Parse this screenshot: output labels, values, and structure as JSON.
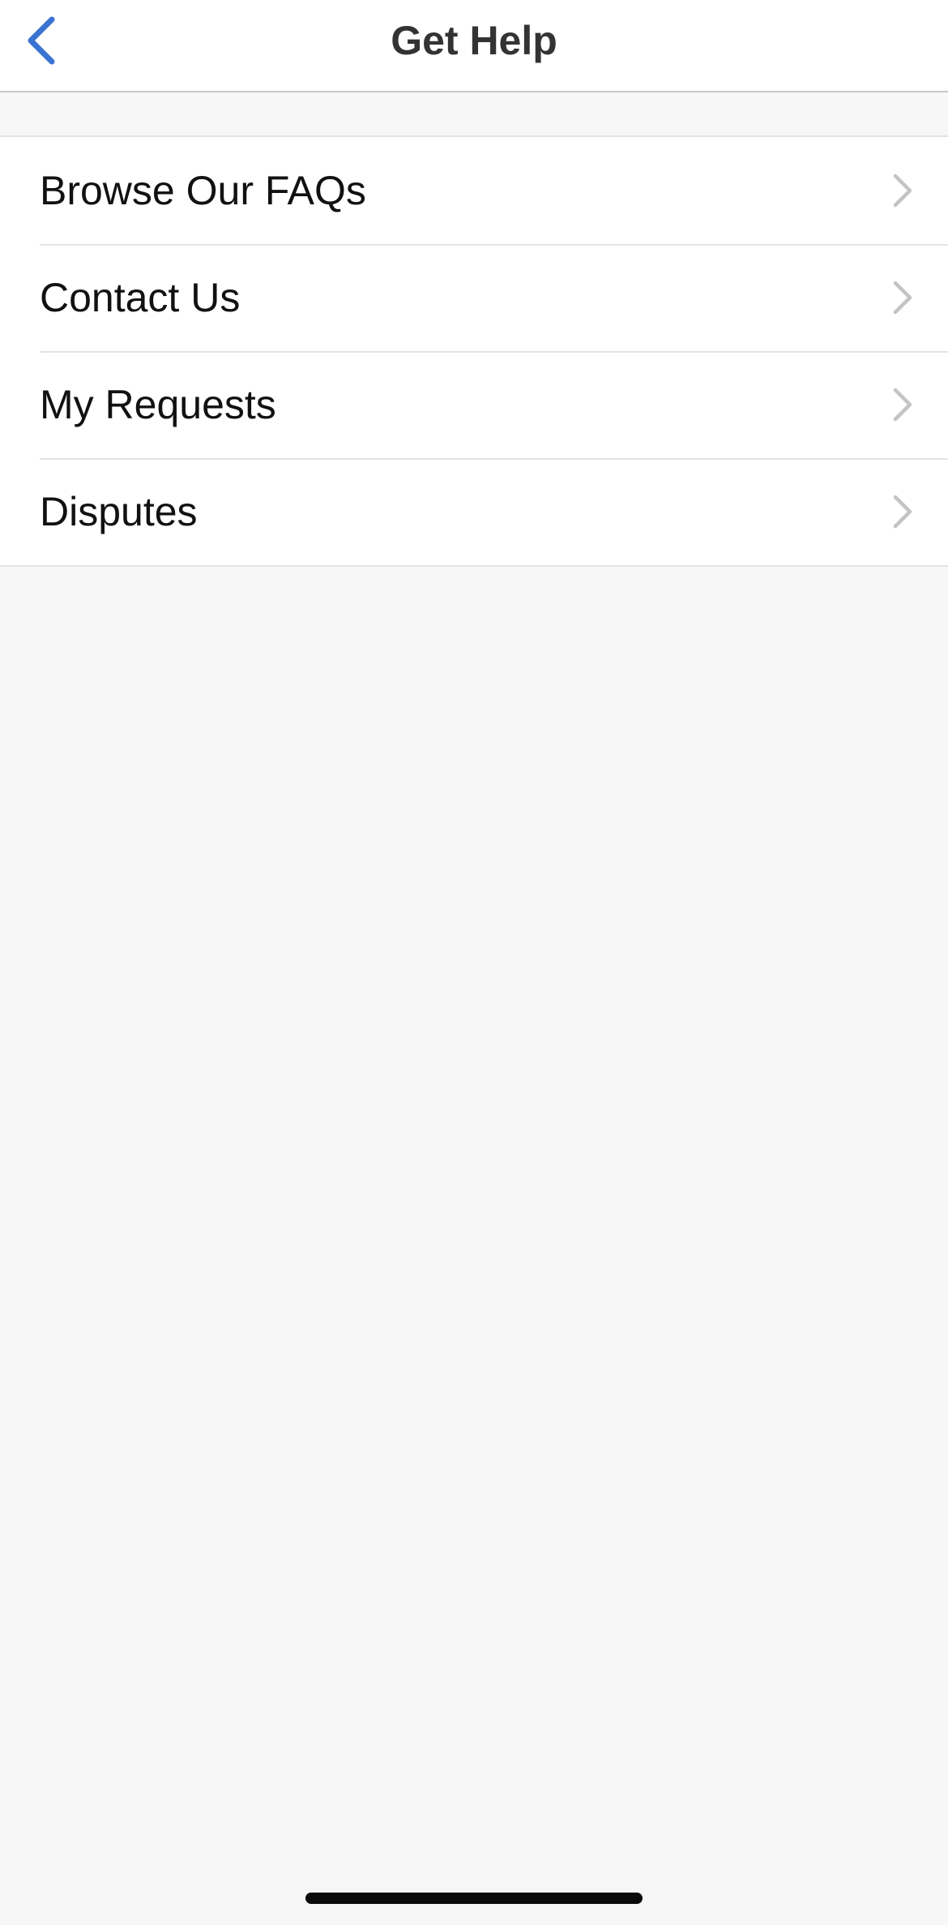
{
  "nav": {
    "title": "Get Help",
    "back_icon": "chevron-left-icon",
    "accent_color": "#3b73d1"
  },
  "menu": {
    "items": [
      {
        "label": "Browse Our FAQs",
        "icon": "chevron-right-icon"
      },
      {
        "label": "Contact Us",
        "icon": "chevron-right-icon"
      },
      {
        "label": "My Requests",
        "icon": "chevron-right-icon"
      },
      {
        "label": "Disputes",
        "icon": "chevron-right-icon"
      }
    ]
  },
  "colors": {
    "background": "#f7f7f7",
    "surface": "#ffffff",
    "separator": "#e3e3e3",
    "chevron": "#c4c4c6"
  }
}
